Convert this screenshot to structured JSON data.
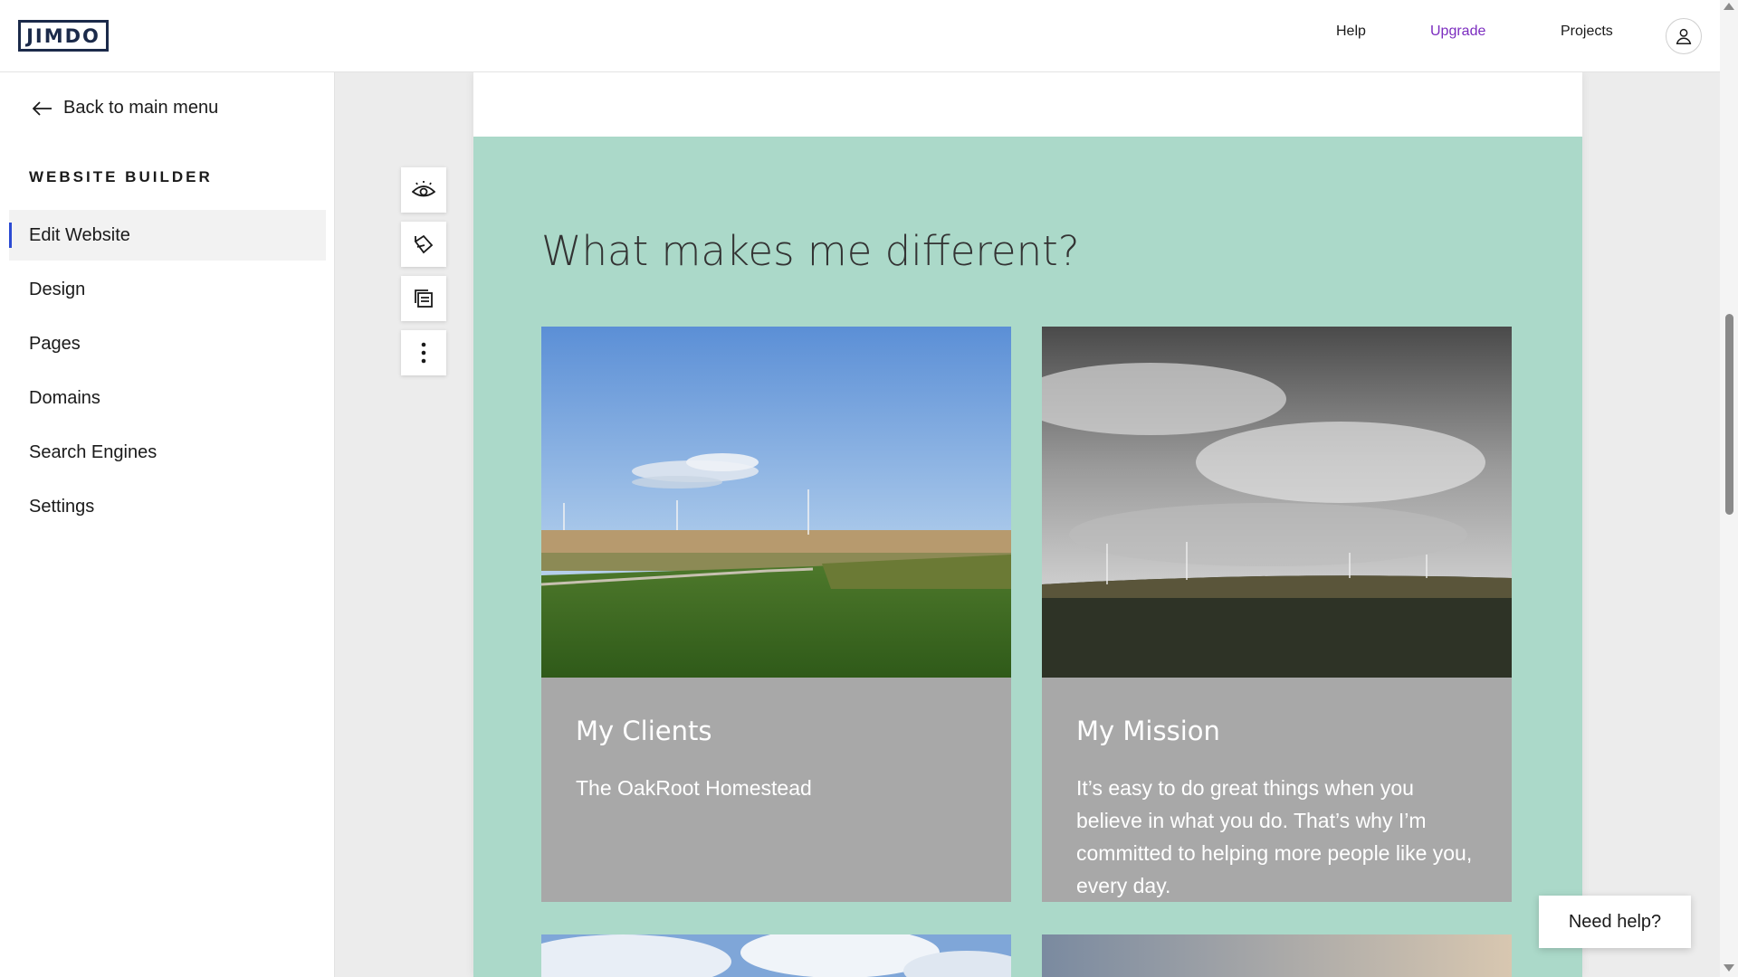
{
  "header": {
    "logo_text": "JIMDO",
    "nav": {
      "help": "Help",
      "upgrade": "Upgrade",
      "projects": "Projects"
    },
    "upgrade_color": "#7b2cbf"
  },
  "sidebar": {
    "back_label": "Back to main menu",
    "section_title": "WEBSITE BUILDER",
    "items": [
      {
        "label": "Edit Website",
        "active": true
      },
      {
        "label": "Design"
      },
      {
        "label": "Pages"
      },
      {
        "label": "Domains"
      },
      {
        "label": "Search Engines"
      },
      {
        "label": "Settings"
      }
    ],
    "active_indicator_color": "#2c4bd3"
  },
  "toolbar": {
    "icons": [
      "eye-icon",
      "paint-bucket-icon",
      "copy-icon",
      "more-vertical-icon"
    ]
  },
  "content": {
    "section_background": "#abd9c9",
    "heading": "What makes me different?",
    "cards": [
      {
        "image": "wind-turbines-field-sunny-photo",
        "title": "My Clients",
        "text": "The OakRoot Homestead"
      },
      {
        "image": "wind-turbines-cloudy-sky-photo",
        "title": "My Mission",
        "text": "It’s easy to do great things when you believe in what you do. That’s why I’m committed to helping more people like you, every day."
      }
    ],
    "card_background": "#a8a8a8"
  },
  "help_button": {
    "label": "Need help?"
  }
}
